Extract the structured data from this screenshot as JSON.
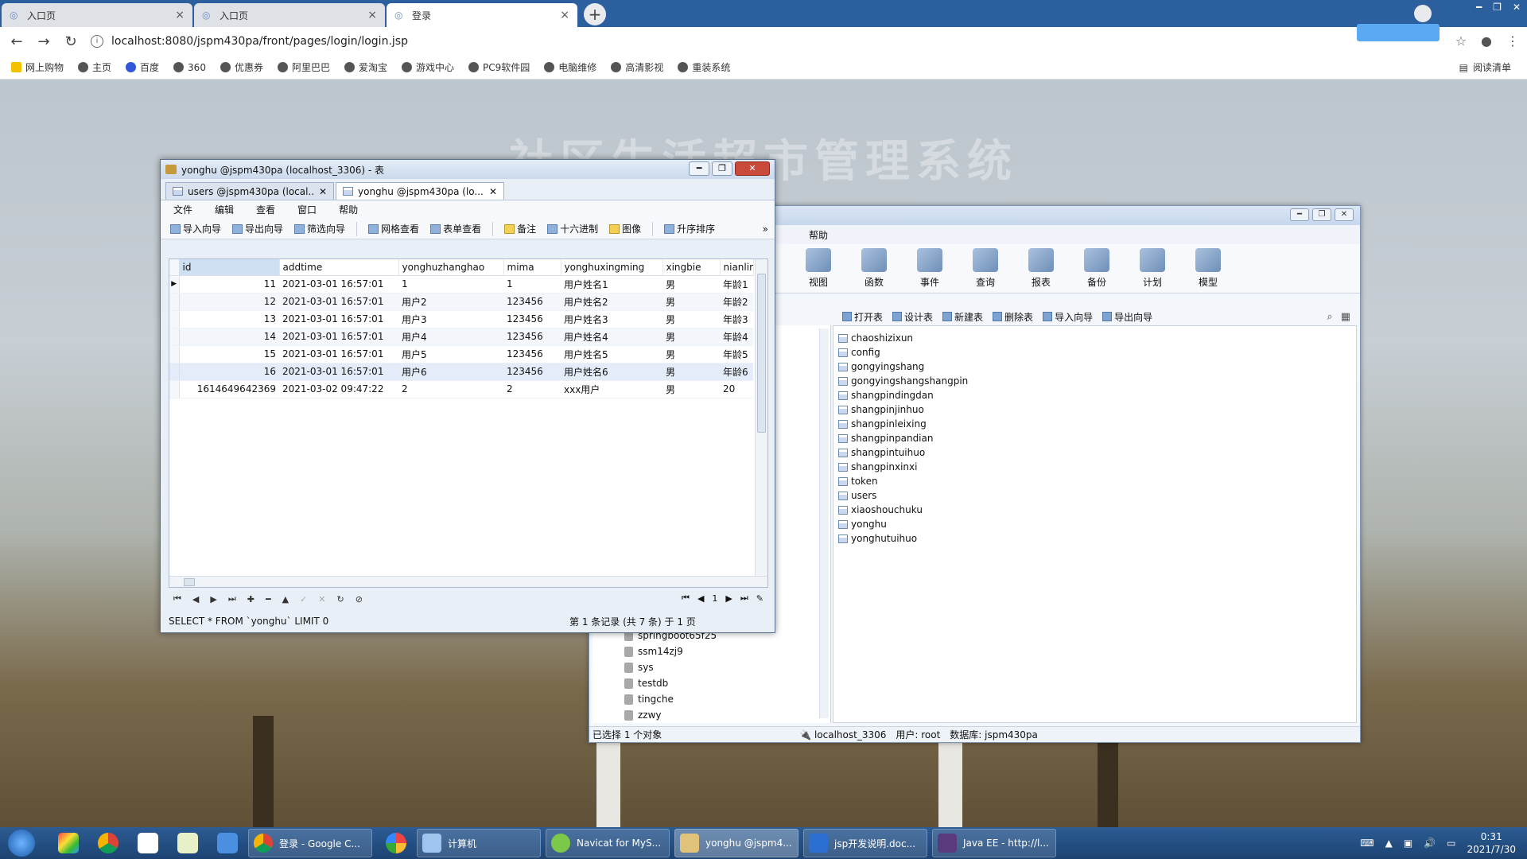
{
  "browser": {
    "tabs": [
      {
        "title": "入口页",
        "active": false
      },
      {
        "title": "入口页",
        "active": false
      },
      {
        "title": "登录",
        "active": true
      }
    ],
    "url": "localhost:8080/jspm430pa/front/pages/login/login.jsp",
    "bookmarks": [
      "网上购物",
      "主页",
      "百度",
      "360",
      "优惠券",
      "阿里巴巴",
      "爱淘宝",
      "游戏中心",
      "PC9软件园",
      "电脑维修",
      "高清影视",
      "重装系统"
    ],
    "reading_list": "阅读清单"
  },
  "page": {
    "title": "社区生活超市管理系统"
  },
  "navicat": {
    "menu_help": "帮助",
    "tools": [
      "视图",
      "函数",
      "事件",
      "查询",
      "报表",
      "备份",
      "计划",
      "模型"
    ],
    "subtools": [
      "打开表",
      "设计表",
      "新建表",
      "删除表",
      "导入向导",
      "导出向导"
    ],
    "tables": [
      "chaoshizixun",
      "config",
      "gongyingshang",
      "gongyingshangshangpin",
      "shangpindingdan",
      "shangpinjinhuo",
      "shangpinleixing",
      "shangpinpandian",
      "shangpintuihuo",
      "shangpinxinxi",
      "token",
      "users",
      "xiaoshouchuku",
      "yonghu",
      "yonghutuihuo"
    ],
    "databases": [
      "springboot65f25",
      "ssm14zj9",
      "sys",
      "testdb",
      "tingche",
      "zzwy"
    ],
    "status_left": "已选择 1 个对象",
    "status_conn": "localhost_3306",
    "status_user": "用户: root",
    "status_db": "数据库: jspm430pa"
  },
  "table_window": {
    "title": "yonghu @jspm430pa (localhost_3306) - 表",
    "tabs": [
      "users @jspm430pa (local...",
      "yonghu @jspm430pa (lo..."
    ],
    "menu": [
      "文件",
      "编辑",
      "查看",
      "窗口",
      "帮助"
    ],
    "toolbar": [
      "导入向导",
      "导出向导",
      "筛选向导",
      "网格查看",
      "表单查看",
      "备注",
      "十六进制",
      "图像",
      "升序排序"
    ],
    "columns": [
      "id",
      "addtime",
      "yonghuzhanghao",
      "mima",
      "yonghuxingming",
      "xingbie",
      "nianling"
    ],
    "rows": [
      [
        "11",
        "2021-03-01 16:57:01",
        "1",
        "1",
        "用户姓名1",
        "男",
        "年龄1"
      ],
      [
        "12",
        "2021-03-01 16:57:01",
        "用户2",
        "123456",
        "用户姓名2",
        "男",
        "年龄2"
      ],
      [
        "13",
        "2021-03-01 16:57:01",
        "用户3",
        "123456",
        "用户姓名3",
        "男",
        "年龄3"
      ],
      [
        "14",
        "2021-03-01 16:57:01",
        "用户4",
        "123456",
        "用户姓名4",
        "男",
        "年龄4"
      ],
      [
        "15",
        "2021-03-01 16:57:01",
        "用户5",
        "123456",
        "用户姓名5",
        "男",
        "年龄5"
      ],
      [
        "16",
        "2021-03-01 16:57:01",
        "用户6",
        "123456",
        "用户姓名6",
        "男",
        "年龄6"
      ],
      [
        "1614649642369",
        "2021-03-02 09:47:22",
        "2",
        "2",
        "xxx用户",
        "男",
        "20"
      ]
    ],
    "page_number": "1",
    "sql": "SELECT * FROM `yonghu` LIMIT 0",
    "record_info": "第 1 条记录 (共 7 条) 于 1 页"
  },
  "taskbar": {
    "tasks": [
      "登录 - Google C...",
      "计算机",
      "Navicat for MyS...",
      "yonghu @jspm4...",
      "jsp开发说明.doc...",
      "Java EE - http://l..."
    ],
    "time": "0:31",
    "date": "2021/7/30"
  }
}
